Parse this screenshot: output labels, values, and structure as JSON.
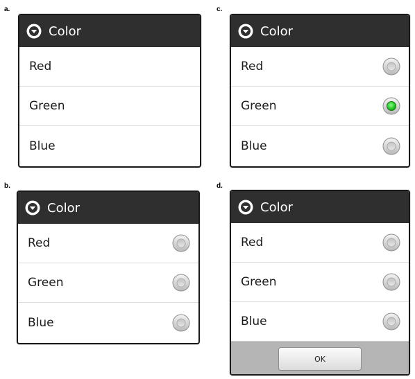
{
  "panels": [
    {
      "letter": "a.",
      "title": "Color",
      "options": [
        {
          "label": "Red",
          "radio": "none"
        },
        {
          "label": "Green",
          "radio": "none"
        },
        {
          "label": "Blue",
          "radio": "none"
        }
      ]
    },
    {
      "letter": "b.",
      "title": "Color",
      "options": [
        {
          "label": "Red",
          "radio": "unchecked"
        },
        {
          "label": "Green",
          "radio": "unchecked"
        },
        {
          "label": "Blue",
          "radio": "unchecked"
        }
      ]
    },
    {
      "letter": "c.",
      "title": "Color",
      "options": [
        {
          "label": "Red",
          "radio": "unchecked"
        },
        {
          "label": "Green",
          "radio": "checked"
        },
        {
          "label": "Blue",
          "radio": "unchecked"
        }
      ]
    },
    {
      "letter": "d.",
      "title": "Color",
      "options": [
        {
          "label": "Red",
          "radio": "unchecked"
        },
        {
          "label": "Green",
          "radio": "unchecked"
        },
        {
          "label": "Blue",
          "radio": "unchecked"
        }
      ],
      "button_label": "OK"
    }
  ],
  "colors": {
    "header_bg": "#2f2f2f",
    "radio_checked": "#2fd12f",
    "button_bar_bg": "#b5b5b5"
  },
  "icons": {
    "header": "circle-chevron-down-icon",
    "radio": "radio-button-icon"
  }
}
